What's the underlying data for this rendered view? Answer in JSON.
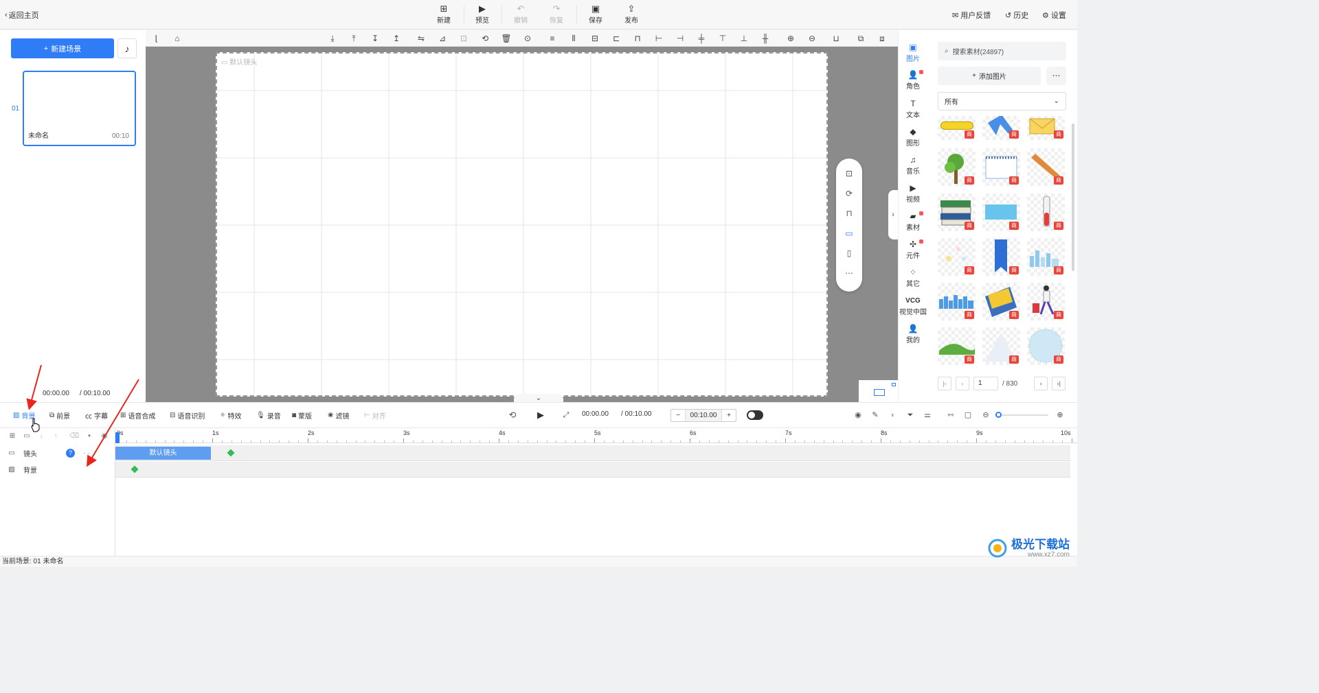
{
  "topbar": {
    "back_label": "返回主页",
    "actions": [
      {
        "label": "新建",
        "icon": "new-icon",
        "enabled": true
      },
      {
        "label": "预览",
        "icon": "preview-play-icon",
        "enabled": true
      },
      {
        "label": "撤销",
        "icon": "undo-icon",
        "enabled": false
      },
      {
        "label": "恢复",
        "icon": "redo-icon",
        "enabled": false
      },
      {
        "label": "保存",
        "icon": "save-icon",
        "enabled": true
      },
      {
        "label": "发布",
        "icon": "publish-icon",
        "enabled": true
      }
    ],
    "right": [
      {
        "label": "用户反馈",
        "icon": "feedback-icon"
      },
      {
        "label": "历史",
        "icon": "history-icon"
      },
      {
        "label": "设置",
        "icon": "settings-icon"
      }
    ]
  },
  "scenes": {
    "new_scene_label": "新建场景",
    "items": [
      {
        "index": "01",
        "name": "未命名",
        "duration": "00:10"
      }
    ],
    "current_time": "00:00.00",
    "total_time": "/ 00:10.00"
  },
  "canvas": {
    "default_shot_label": "默认镜头"
  },
  "side_tabs": [
    {
      "label": "图片",
      "icon": "image-icon",
      "active": true,
      "dot": false
    },
    {
      "label": "角色",
      "icon": "character-icon",
      "active": false,
      "dot": true
    },
    {
      "label": "文本",
      "icon": "text-icon",
      "active": false,
      "dot": false
    },
    {
      "label": "图形",
      "icon": "shape-icon",
      "active": false,
      "dot": false
    },
    {
      "label": "音乐",
      "icon": "music-icon",
      "active": false,
      "dot": false
    },
    {
      "label": "视频",
      "icon": "video-icon",
      "active": false,
      "dot": false
    },
    {
      "label": "素材",
      "icon": "material-icon",
      "active": false,
      "dot": true
    },
    {
      "label": "元件",
      "icon": "component-icon",
      "active": false,
      "dot": true
    },
    {
      "label": "其它",
      "icon": "other-icon",
      "active": false,
      "dot": false
    },
    {
      "label": "视觉中国",
      "icon": "vcg-logo",
      "logo_text": "VCG",
      "active": false,
      "dot": false
    },
    {
      "label": "我的",
      "icon": "user-icon",
      "active": false,
      "dot": false
    }
  ],
  "assets": {
    "search_placeholder": "搜索素材(24897)",
    "add_image_label": "添加图片",
    "filter_value": "所有",
    "badge": "商",
    "page": "1",
    "total_pages": "/ 830",
    "tiles": [
      "yellow-bar",
      "blue-arrow",
      "envelope",
      "tree",
      "notepad",
      "pencil",
      "books",
      "blue-rect",
      "test-tube",
      "sparkles",
      "bookmark",
      "city-skyline",
      "blue-skyline",
      "open-envelope",
      "traveler",
      "grass-hill",
      "white-triangle",
      "dotted-circle"
    ]
  },
  "bottom_toolbar": {
    "left": [
      {
        "label": "背景",
        "icon": "background-icon",
        "active": true
      },
      {
        "label": "前景",
        "icon": "foreground-icon",
        "active": false
      },
      {
        "label": "字幕",
        "icon": "subtitle-icon",
        "active": false
      },
      {
        "label": "语音合成",
        "icon": "tts-icon",
        "active": false
      },
      {
        "label": "语音识别",
        "icon": "asr-icon",
        "active": false
      },
      {
        "label": "特效",
        "icon": "effects-icon",
        "active": false
      },
      {
        "label": "录音",
        "icon": "mic-icon",
        "active": false
      },
      {
        "label": "蒙版",
        "icon": "mask-icon",
        "active": false
      },
      {
        "label": "滤镜",
        "icon": "filter-icon",
        "active": false
      },
      {
        "label": "对齐",
        "icon": "align-icon",
        "active": false,
        "disabled": true
      }
    ],
    "current_time": "00:00.00",
    "total_time": "/ 00:10.00",
    "zoom_value": "00:10.00",
    "zoom_minus": "−",
    "zoom_plus": "+"
  },
  "timeline": {
    "ticks": [
      "0s",
      "1s",
      "2s",
      "3s",
      "4s",
      "5s",
      "6s",
      "7s",
      "8s",
      "9s",
      "10s"
    ],
    "tracks": [
      {
        "label": "镜头",
        "icon": "camera-icon",
        "clip": "默认镜头"
      },
      {
        "label": "背景",
        "icon": "background-icon"
      }
    ]
  },
  "status": {
    "current_scene": "当前场景: 01  未命名"
  },
  "watermark": {
    "text": "极光下载站",
    "url": "www.xz7.com"
  },
  "colors": {
    "accent": "#2e7cf6",
    "clip": "#5e9df0",
    "keyframe": "#3cb85c",
    "annotation_arrow": "#e8261e"
  }
}
